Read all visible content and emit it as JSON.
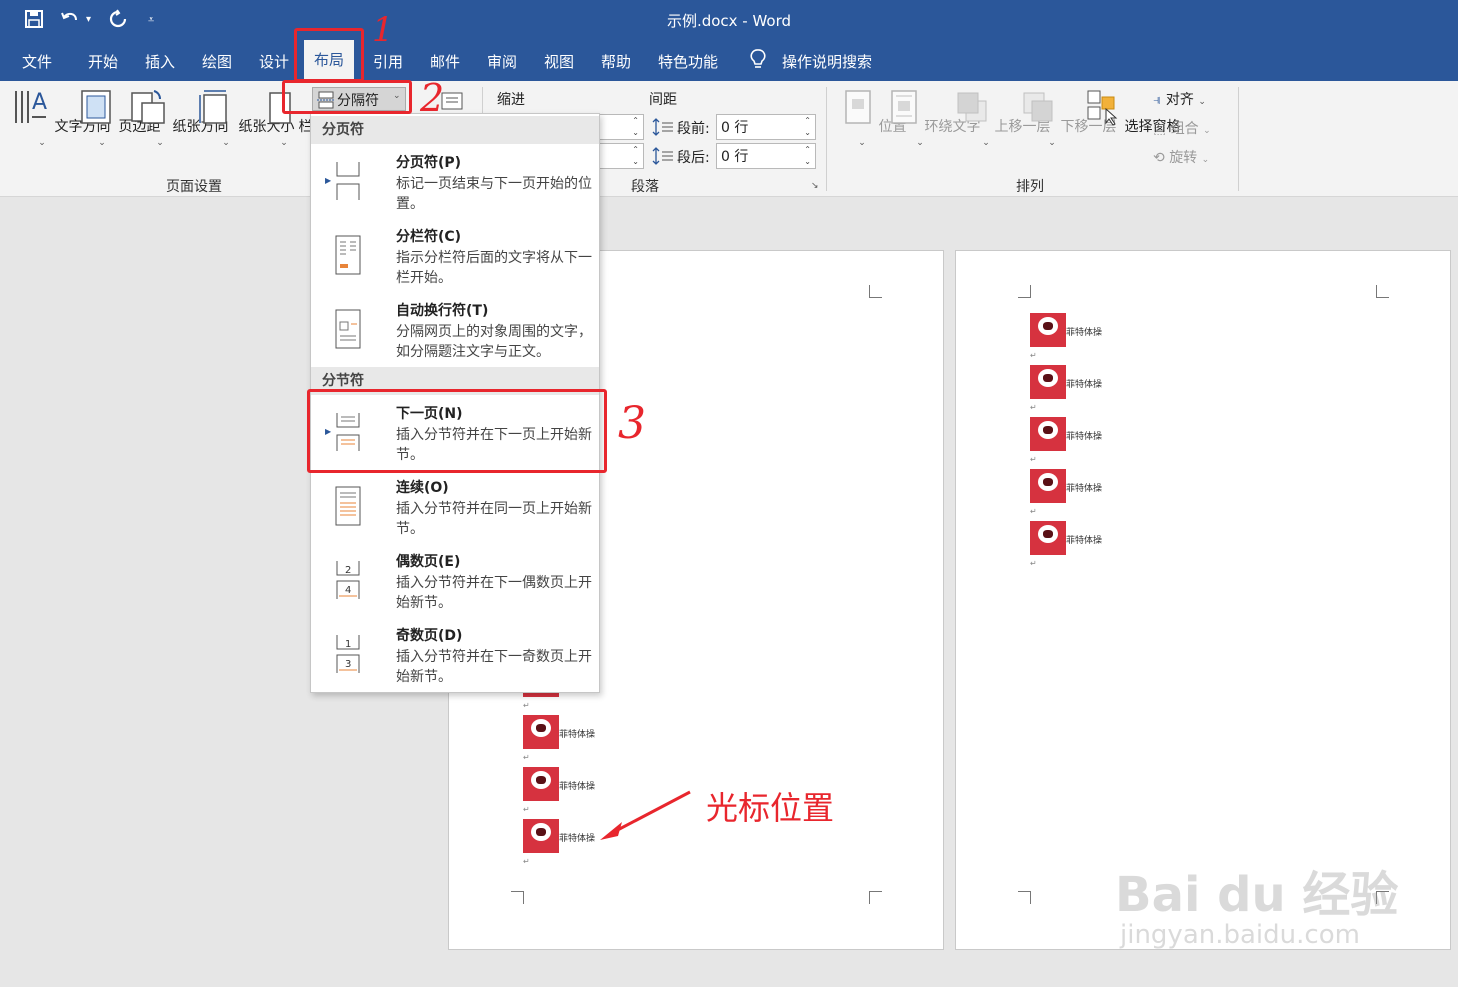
{
  "window": {
    "title": "示例.docx  -  Word"
  },
  "tabs": [
    "文件",
    "开始",
    "插入",
    "绘图",
    "设计",
    "布局",
    "引用",
    "邮件",
    "审阅",
    "视图",
    "帮助",
    "特色功能"
  ],
  "active_tab": "布局",
  "search": {
    "label": "操作说明搜索"
  },
  "ribbon": {
    "page_setup": {
      "group_label": "页面设置",
      "buttons": [
        "文字方向",
        "页边距",
        "纸张方向",
        "纸张大小",
        "栏"
      ],
      "breaks_button": "分隔符"
    },
    "paragraph": {
      "group_label": "段落",
      "indent_label": "缩进",
      "spacing_label": "间距",
      "before_label": "段前:",
      "before_value": "0 行",
      "after_label": "段后:",
      "after_value": "0 行"
    },
    "arrange": {
      "group_label": "排列",
      "buttons": [
        "位置",
        "环绕文字",
        "上移一层",
        "下移一层",
        "选择窗格"
      ],
      "small_buttons": [
        "对齐",
        "组合",
        "旋转"
      ]
    }
  },
  "dropdown": {
    "page_breaks_header": "分页符",
    "section_breaks_header": "分节符",
    "items": [
      {
        "title": "分页符(P)",
        "desc": "标记一页结束与下一页开始的位置。"
      },
      {
        "title": "分栏符(C)",
        "desc": "指示分栏符后面的文字将从下一栏开始。"
      },
      {
        "title": "自动换行符(T)",
        "desc": "分隔网页上的对象周围的文字，如分隔题注文字与正文。"
      },
      {
        "title": "下一页(N)",
        "desc": "插入分节符并在下一页上开始新节。"
      },
      {
        "title": "连续(O)",
        "desc": "插入分节符并在同一页上开始新节。"
      },
      {
        "title": "偶数页(E)",
        "desc": "插入分节符并在下一偶数页上开始新节。"
      },
      {
        "title": "奇数页(D)",
        "desc": "插入分节符并在下一奇数页上开始新节。"
      }
    ]
  },
  "document": {
    "image_caption": "菲特体操"
  },
  "annotations": {
    "step1": "1",
    "step2": "2",
    "step3": "3",
    "cursor_label": "光标位置",
    "color": "#e8262d"
  },
  "watermark": {
    "line1": "Bai du 经验",
    "line2": "jingyan.baidu.com"
  },
  "colors": {
    "accent": "#2b579a"
  }
}
